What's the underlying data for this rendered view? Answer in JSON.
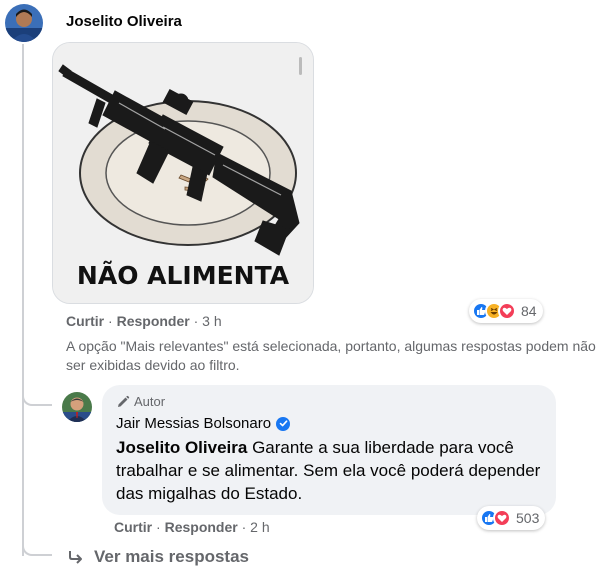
{
  "comment": {
    "author": "Joselito Oliveira",
    "sticker_text": "NÃO ALIMENTA",
    "actions": {
      "like": "Curtir",
      "reply": "Responder",
      "time": "3 h"
    },
    "reactions": {
      "icons": [
        "like-icon",
        "haha-icon",
        "love-icon"
      ],
      "count": "84"
    }
  },
  "notice": "A opção \"Mais relevantes\" está selecionada, portanto, algumas respostas podem não ser exibidas devido ao filtro.",
  "reply": {
    "badge": "Autor",
    "author": "Jair Messias Bolsonaro",
    "mention": "Joselito Oliveira",
    "text": " Garante a sua liberdade para você trabalhar e se alimentar. Sem ela você poderá depender das migalhas do Estado.",
    "actions": {
      "like": "Curtir",
      "reply": "Responder",
      "time": "2 h"
    },
    "reactions": {
      "icons": [
        "like-icon",
        "love-icon"
      ],
      "count": "503"
    }
  },
  "more_replies": "Ver mais respostas",
  "colors": {
    "like": "#1877f2",
    "love": "#f33e58",
    "haha": "#f7b125",
    "muted": "#65676b",
    "bubble": "#f0f2f5"
  }
}
